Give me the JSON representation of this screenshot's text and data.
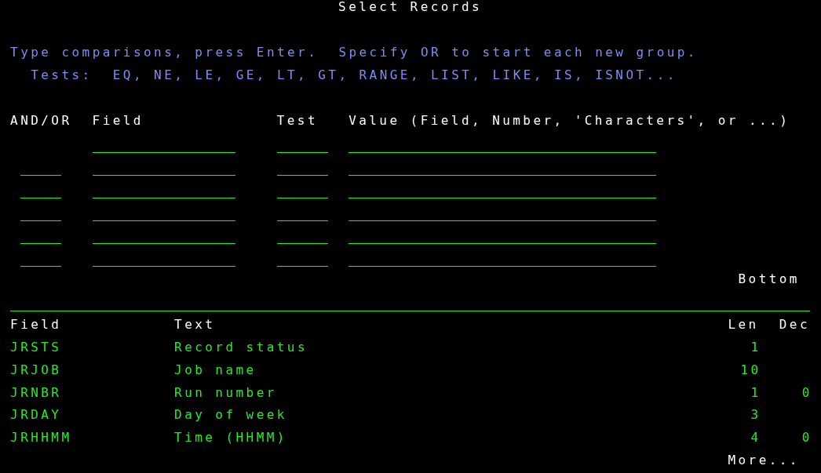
{
  "title": "Select Records",
  "instructions": [
    "Type comparisons, press Enter.  Specify OR to start each new group.",
    "  Tests:  EQ, NE, LE, GE, LT, GT, RANGE, LIST, LIKE, IS, ISNOT..."
  ],
  "criteria_headers": {
    "and_or": "AND/OR",
    "field": "Field",
    "test": "Test",
    "value": "Value (Field, Number, 'Characters', or ...)"
  },
  "criteria_rows": [
    {
      "has_and_or": false
    },
    {
      "has_and_or": true
    },
    {
      "has_and_or": true
    },
    {
      "has_and_or": true
    },
    {
      "has_and_or": true
    },
    {
      "has_and_or": true
    }
  ],
  "criteria_status": "Bottom",
  "field_list": {
    "columns": [
      "Field",
      "Text",
      "Len",
      "Dec"
    ],
    "rows": [
      {
        "field": "JRSTS",
        "text": "Record status",
        "len": "1",
        "dec": ""
      },
      {
        "field": "JRJOB",
        "text": "Job name",
        "len": "10",
        "dec": ""
      },
      {
        "field": "JRNBR",
        "text": "Run number",
        "len": "1",
        "dec": "0"
      },
      {
        "field": "JRDAY",
        "text": "Day of week",
        "len": "3",
        "dec": ""
      },
      {
        "field": "JRHHMM",
        "text": "Time (HHMM)",
        "len": "4",
        "dec": "0"
      }
    ],
    "status": "More..."
  }
}
